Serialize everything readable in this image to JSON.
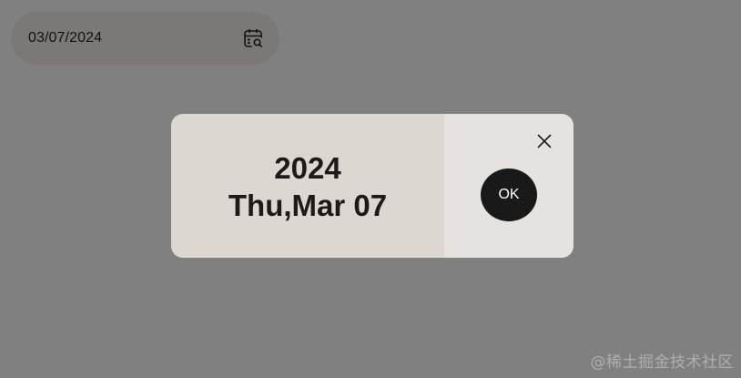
{
  "date_input": {
    "value": "03/07/2024",
    "icon": "calendar-search-icon"
  },
  "dialog": {
    "year": "2024",
    "date_label": "Thu,Mar 07",
    "ok_label": "OK",
    "close_icon": "close-icon"
  },
  "watermark": {
    "text": "@稀土掘金技术社区"
  },
  "colors": {
    "backdrop": "#808080",
    "dialog_left": "#dcd7d1",
    "dialog_right": "#e5e2df",
    "ok_button": "#191919"
  }
}
